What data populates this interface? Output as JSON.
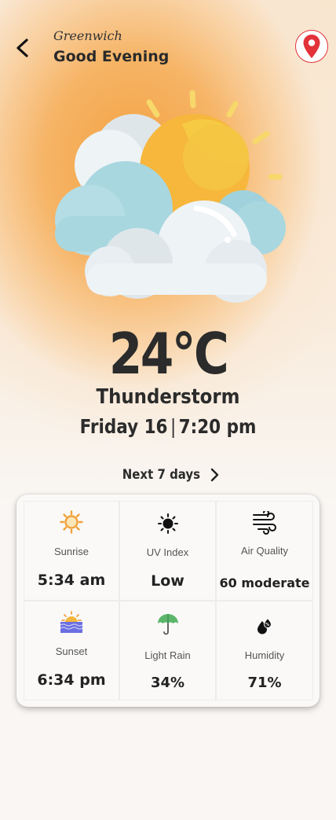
{
  "header": {
    "city": "Greenwich",
    "greeting": "Good Evening"
  },
  "current": {
    "temperature": "24°C",
    "condition": "Thunderstorm",
    "day": "Friday 16",
    "separator": "|",
    "time": "7:20 pm"
  },
  "forecast_link": {
    "label": "Next 7 days"
  },
  "stats": [
    {
      "icon": "sunrise-icon",
      "label": "Sunrise",
      "value": "5:34 am"
    },
    {
      "icon": "uv-sun-icon",
      "label": "UV Index",
      "value": "Low"
    },
    {
      "icon": "wind-icon",
      "label": "Air Quality",
      "value": "60 moderate"
    },
    {
      "icon": "sunset-icon",
      "label": "Sunset",
      "value": "6:34 pm"
    },
    {
      "icon": "umbrella-icon",
      "label": "Light Rain",
      "value": "34%"
    },
    {
      "icon": "humidity-drops-icon",
      "label": "Humidity",
      "value": "71%"
    }
  ],
  "colors": {
    "accent_orange": "#f3a13f",
    "pin_red": "#e2323a",
    "text_dark": "#2b2b2b"
  }
}
